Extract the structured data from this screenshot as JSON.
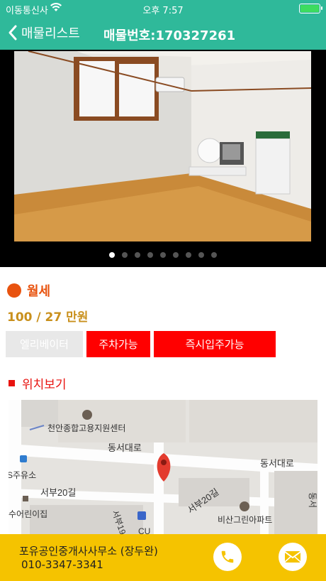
{
  "status_bar": {
    "carrier": "이동통신사",
    "time": "오후 7:57"
  },
  "nav": {
    "back_label": "매물리스트",
    "title": "매물번호:170327261"
  },
  "gallery": {
    "dot_count": 9,
    "active_index": 0
  },
  "listing": {
    "type": "월세",
    "price": "100 / 27 만원",
    "tags": [
      {
        "label": "엘리베이터",
        "active": false
      },
      {
        "label": "주차가능",
        "active": true
      },
      {
        "label": "즉시입주가능",
        "active": true
      }
    ]
  },
  "location": {
    "label": "위치보기"
  },
  "map": {
    "labels": {
      "center": "천안종합고용지원센터",
      "road1": "동서대로",
      "road2": "동서대로",
      "gas": "S주유소",
      "road3": "서부20길",
      "road4": "서부20길",
      "shop": "수어린이집",
      "apt": "비산그린아파트",
      "road5": "서부19",
      "cu": "CU",
      "side": "동서"
    }
  },
  "footer": {
    "office": "포유공인중개사사무소 (장두완)",
    "phone": "010-3347-3341"
  },
  "colors": {
    "accent": "#2fb99a",
    "red": "#ff0000",
    "orange": "#e8530f",
    "gold": "#c9901c",
    "footer": "#f5c300"
  }
}
